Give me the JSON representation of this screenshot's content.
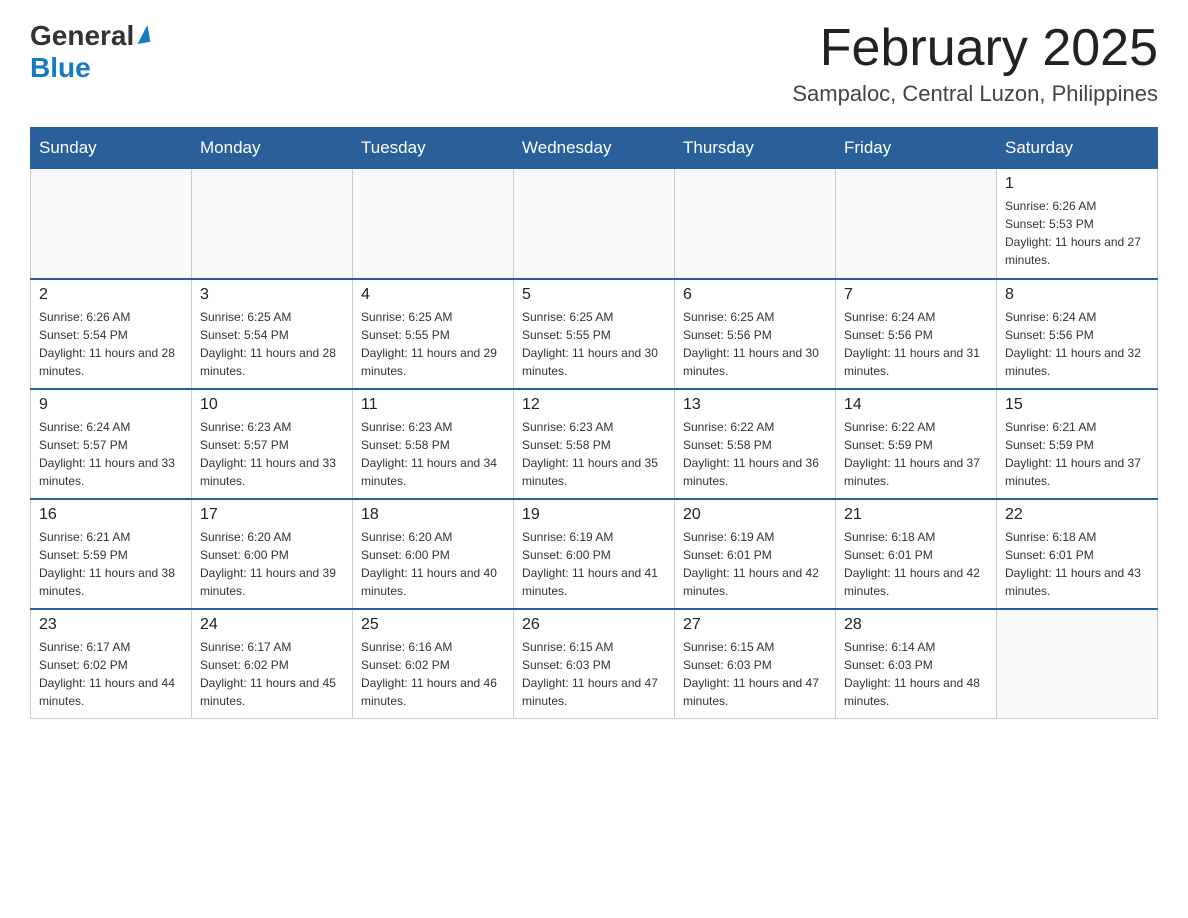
{
  "header": {
    "logo": {
      "general": "General",
      "blue": "Blue",
      "arrow": "▶"
    },
    "title": "February 2025",
    "subtitle": "Sampaloc, Central Luzon, Philippines"
  },
  "days_of_week": [
    "Sunday",
    "Monday",
    "Tuesday",
    "Wednesday",
    "Thursday",
    "Friday",
    "Saturday"
  ],
  "weeks": [
    [
      {
        "day": "",
        "sunrise": "",
        "sunset": "",
        "daylight": "",
        "empty": true
      },
      {
        "day": "",
        "sunrise": "",
        "sunset": "",
        "daylight": "",
        "empty": true
      },
      {
        "day": "",
        "sunrise": "",
        "sunset": "",
        "daylight": "",
        "empty": true
      },
      {
        "day": "",
        "sunrise": "",
        "sunset": "",
        "daylight": "",
        "empty": true
      },
      {
        "day": "",
        "sunrise": "",
        "sunset": "",
        "daylight": "",
        "empty": true
      },
      {
        "day": "",
        "sunrise": "",
        "sunset": "",
        "daylight": "",
        "empty": true
      },
      {
        "day": "1",
        "sunrise": "Sunrise: 6:26 AM",
        "sunset": "Sunset: 5:53 PM",
        "daylight": "Daylight: 11 hours and 27 minutes.",
        "empty": false
      }
    ],
    [
      {
        "day": "2",
        "sunrise": "Sunrise: 6:26 AM",
        "sunset": "Sunset: 5:54 PM",
        "daylight": "Daylight: 11 hours and 28 minutes.",
        "empty": false
      },
      {
        "day": "3",
        "sunrise": "Sunrise: 6:25 AM",
        "sunset": "Sunset: 5:54 PM",
        "daylight": "Daylight: 11 hours and 28 minutes.",
        "empty": false
      },
      {
        "day": "4",
        "sunrise": "Sunrise: 6:25 AM",
        "sunset": "Sunset: 5:55 PM",
        "daylight": "Daylight: 11 hours and 29 minutes.",
        "empty": false
      },
      {
        "day": "5",
        "sunrise": "Sunrise: 6:25 AM",
        "sunset": "Sunset: 5:55 PM",
        "daylight": "Daylight: 11 hours and 30 minutes.",
        "empty": false
      },
      {
        "day": "6",
        "sunrise": "Sunrise: 6:25 AM",
        "sunset": "Sunset: 5:56 PM",
        "daylight": "Daylight: 11 hours and 30 minutes.",
        "empty": false
      },
      {
        "day": "7",
        "sunrise": "Sunrise: 6:24 AM",
        "sunset": "Sunset: 5:56 PM",
        "daylight": "Daylight: 11 hours and 31 minutes.",
        "empty": false
      },
      {
        "day": "8",
        "sunrise": "Sunrise: 6:24 AM",
        "sunset": "Sunset: 5:56 PM",
        "daylight": "Daylight: 11 hours and 32 minutes.",
        "empty": false
      }
    ],
    [
      {
        "day": "9",
        "sunrise": "Sunrise: 6:24 AM",
        "sunset": "Sunset: 5:57 PM",
        "daylight": "Daylight: 11 hours and 33 minutes.",
        "empty": false
      },
      {
        "day": "10",
        "sunrise": "Sunrise: 6:23 AM",
        "sunset": "Sunset: 5:57 PM",
        "daylight": "Daylight: 11 hours and 33 minutes.",
        "empty": false
      },
      {
        "day": "11",
        "sunrise": "Sunrise: 6:23 AM",
        "sunset": "Sunset: 5:58 PM",
        "daylight": "Daylight: 11 hours and 34 minutes.",
        "empty": false
      },
      {
        "day": "12",
        "sunrise": "Sunrise: 6:23 AM",
        "sunset": "Sunset: 5:58 PM",
        "daylight": "Daylight: 11 hours and 35 minutes.",
        "empty": false
      },
      {
        "day": "13",
        "sunrise": "Sunrise: 6:22 AM",
        "sunset": "Sunset: 5:58 PM",
        "daylight": "Daylight: 11 hours and 36 minutes.",
        "empty": false
      },
      {
        "day": "14",
        "sunrise": "Sunrise: 6:22 AM",
        "sunset": "Sunset: 5:59 PM",
        "daylight": "Daylight: 11 hours and 37 minutes.",
        "empty": false
      },
      {
        "day": "15",
        "sunrise": "Sunrise: 6:21 AM",
        "sunset": "Sunset: 5:59 PM",
        "daylight": "Daylight: 11 hours and 37 minutes.",
        "empty": false
      }
    ],
    [
      {
        "day": "16",
        "sunrise": "Sunrise: 6:21 AM",
        "sunset": "Sunset: 5:59 PM",
        "daylight": "Daylight: 11 hours and 38 minutes.",
        "empty": false
      },
      {
        "day": "17",
        "sunrise": "Sunrise: 6:20 AM",
        "sunset": "Sunset: 6:00 PM",
        "daylight": "Daylight: 11 hours and 39 minutes.",
        "empty": false
      },
      {
        "day": "18",
        "sunrise": "Sunrise: 6:20 AM",
        "sunset": "Sunset: 6:00 PM",
        "daylight": "Daylight: 11 hours and 40 minutes.",
        "empty": false
      },
      {
        "day": "19",
        "sunrise": "Sunrise: 6:19 AM",
        "sunset": "Sunset: 6:00 PM",
        "daylight": "Daylight: 11 hours and 41 minutes.",
        "empty": false
      },
      {
        "day": "20",
        "sunrise": "Sunrise: 6:19 AM",
        "sunset": "Sunset: 6:01 PM",
        "daylight": "Daylight: 11 hours and 42 minutes.",
        "empty": false
      },
      {
        "day": "21",
        "sunrise": "Sunrise: 6:18 AM",
        "sunset": "Sunset: 6:01 PM",
        "daylight": "Daylight: 11 hours and 42 minutes.",
        "empty": false
      },
      {
        "day": "22",
        "sunrise": "Sunrise: 6:18 AM",
        "sunset": "Sunset: 6:01 PM",
        "daylight": "Daylight: 11 hours and 43 minutes.",
        "empty": false
      }
    ],
    [
      {
        "day": "23",
        "sunrise": "Sunrise: 6:17 AM",
        "sunset": "Sunset: 6:02 PM",
        "daylight": "Daylight: 11 hours and 44 minutes.",
        "empty": false
      },
      {
        "day": "24",
        "sunrise": "Sunrise: 6:17 AM",
        "sunset": "Sunset: 6:02 PM",
        "daylight": "Daylight: 11 hours and 45 minutes.",
        "empty": false
      },
      {
        "day": "25",
        "sunrise": "Sunrise: 6:16 AM",
        "sunset": "Sunset: 6:02 PM",
        "daylight": "Daylight: 11 hours and 46 minutes.",
        "empty": false
      },
      {
        "day": "26",
        "sunrise": "Sunrise: 6:15 AM",
        "sunset": "Sunset: 6:03 PM",
        "daylight": "Daylight: 11 hours and 47 minutes.",
        "empty": false
      },
      {
        "day": "27",
        "sunrise": "Sunrise: 6:15 AM",
        "sunset": "Sunset: 6:03 PM",
        "daylight": "Daylight: 11 hours and 47 minutes.",
        "empty": false
      },
      {
        "day": "28",
        "sunrise": "Sunrise: 6:14 AM",
        "sunset": "Sunset: 6:03 PM",
        "daylight": "Daylight: 11 hours and 48 minutes.",
        "empty": false
      },
      {
        "day": "",
        "sunrise": "",
        "sunset": "",
        "daylight": "",
        "empty": true
      }
    ]
  ]
}
